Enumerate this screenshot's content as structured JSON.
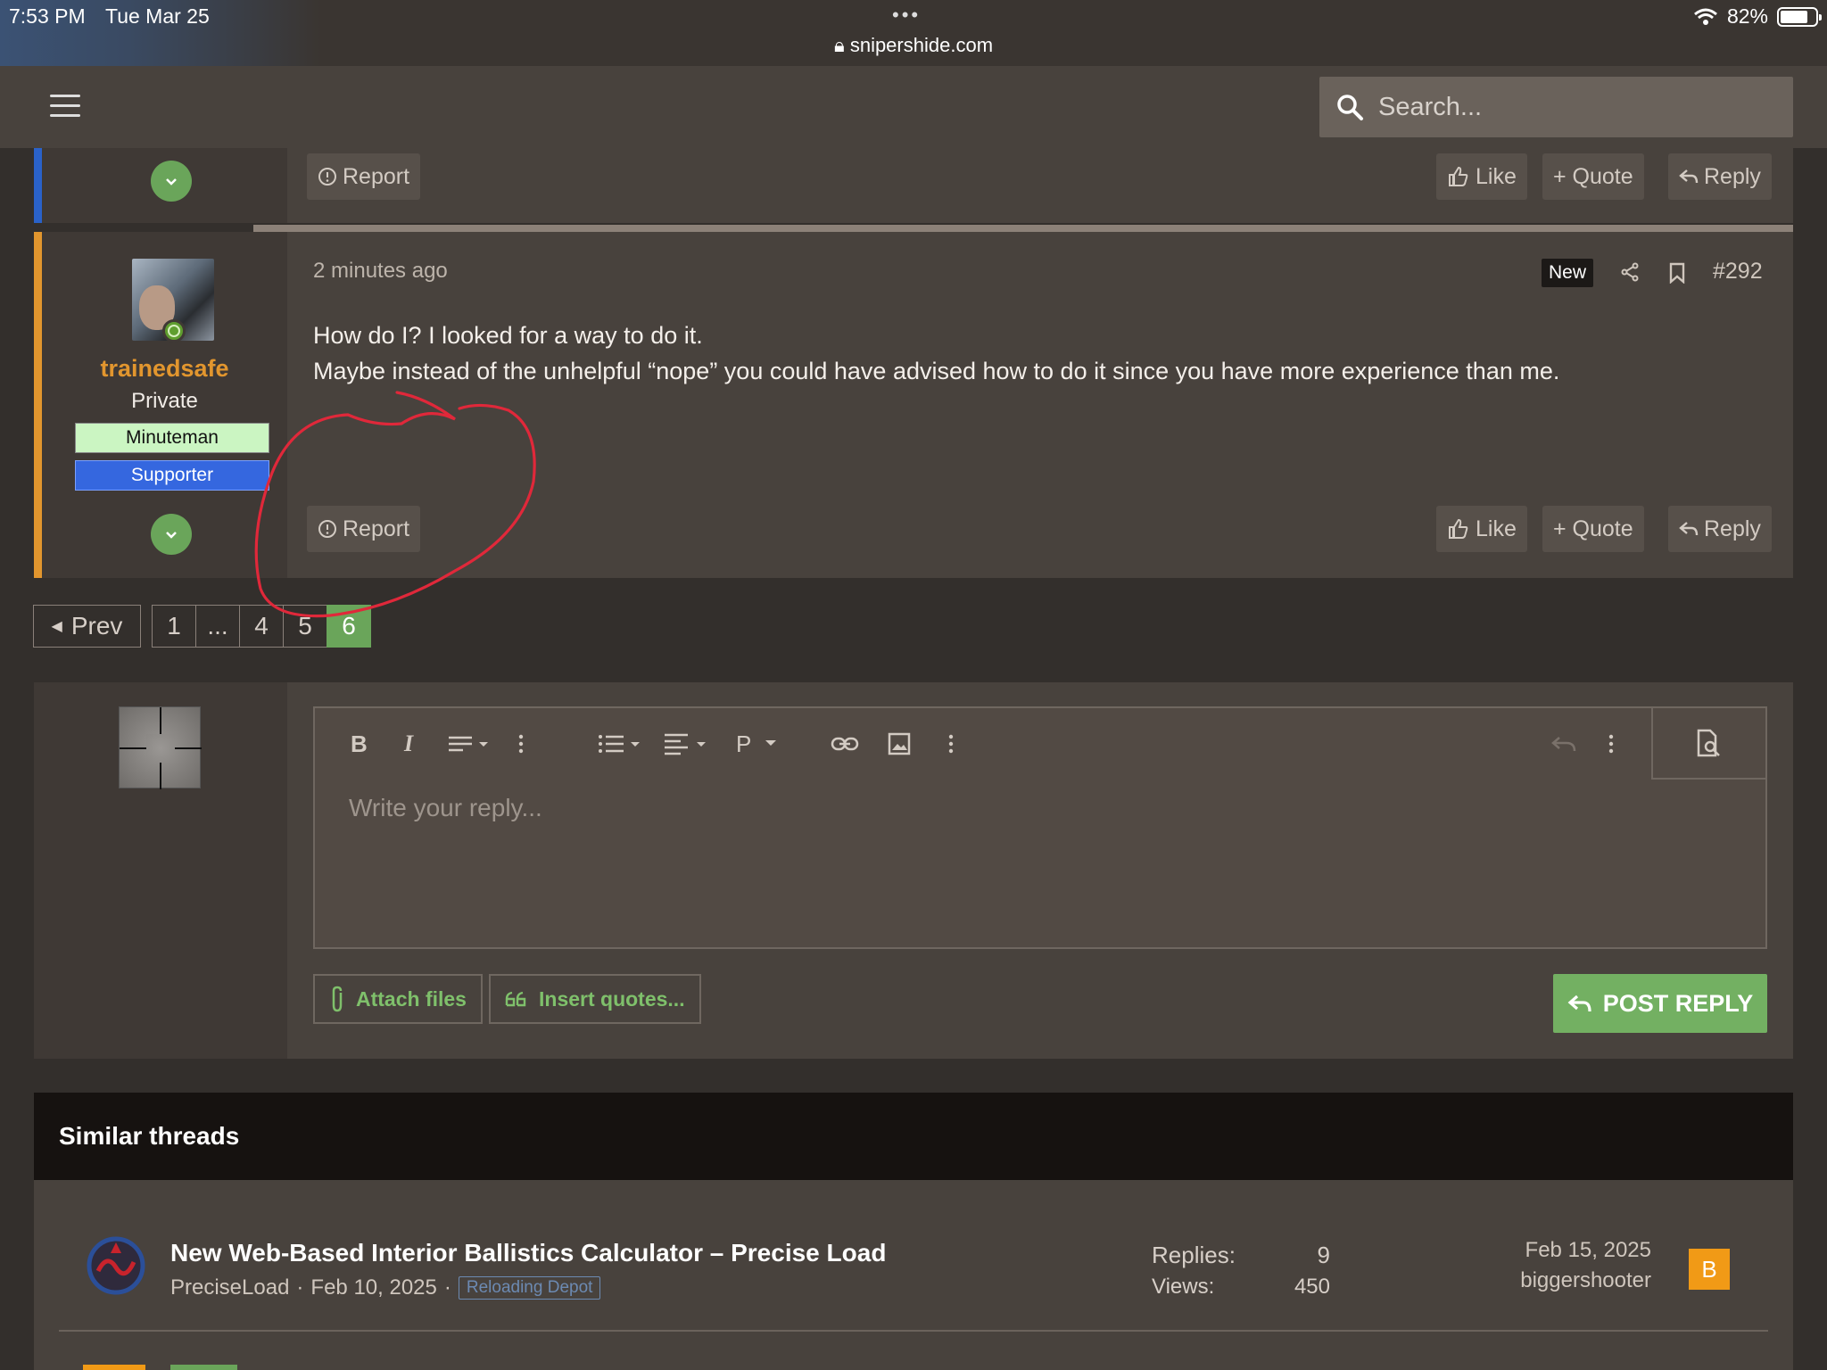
{
  "status": {
    "time": "7:53 PM",
    "day": "Tue Mar 25",
    "url": "snipershide.com",
    "battery": "82%",
    "battery_level": 0.82
  },
  "nav": {
    "search_placeholder": "Search..."
  },
  "actions": {
    "report": "Report",
    "like": "Like",
    "quote": "+ Quote",
    "reply": "Reply"
  },
  "post": {
    "time_ago": "2 minutes ago",
    "new_label": "New",
    "number": "#292",
    "author": "trainedsafe",
    "rank": "Private",
    "badges": [
      "Minuteman",
      "Supporter"
    ],
    "lines": [
      "How do I? I looked for a way to do it.",
      "Maybe instead of the unhelpful “nope” you could have advised how to do it since you have more experience than me."
    ]
  },
  "pagination": {
    "prev": "Prev",
    "pages": [
      "1",
      "...",
      "4",
      "5",
      "6"
    ],
    "current": "6"
  },
  "editor": {
    "placeholder": "Write your reply...",
    "paragraph_label": "P",
    "attach_label": "Attach files",
    "insert_quotes_label": "Insert quotes...",
    "post_reply_label": "POST REPLY"
  },
  "similar": {
    "heading": "Similar threads",
    "thread": {
      "title": "New Web-Based Interior Ballistics Calculator – Precise Load",
      "author": "PreciseLoad",
      "date": "Feb 10, 2025",
      "forum": "Reloading Depot",
      "replies_label": "Replies:",
      "replies": "9",
      "views_label": "Views:",
      "views": "450",
      "last_date": "Feb 15, 2025",
      "last_user": "biggershooter",
      "last_avatar_letter": "B"
    }
  },
  "colors": {
    "accent_green": "#6aa55a",
    "author_orange": "#e2962e",
    "supporter_blue": "#3567df",
    "annotation_red": "#e0283a"
  }
}
